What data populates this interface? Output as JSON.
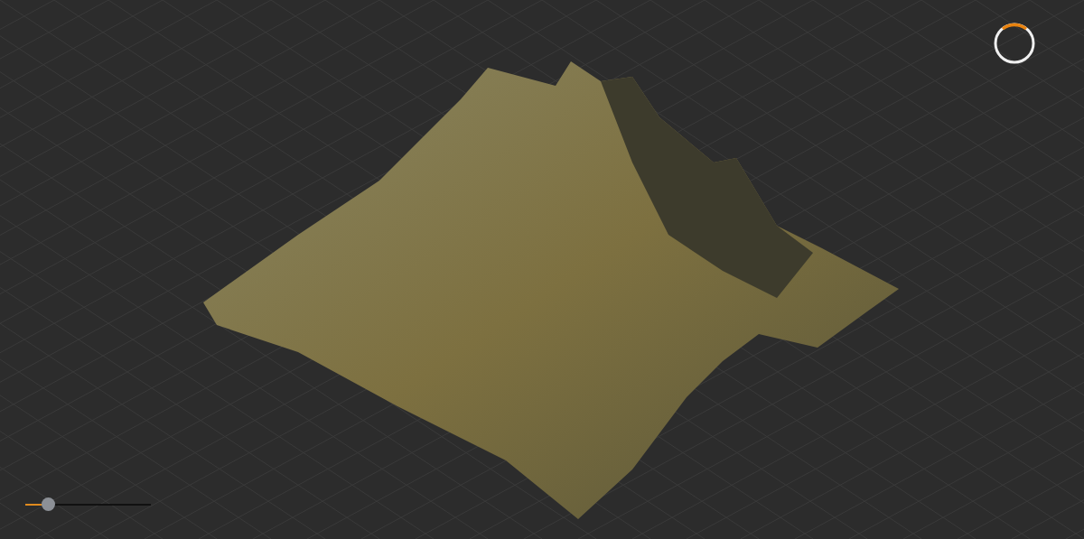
{
  "viewport": {
    "zoom_slider": {
      "level": 0.18
    }
  }
}
